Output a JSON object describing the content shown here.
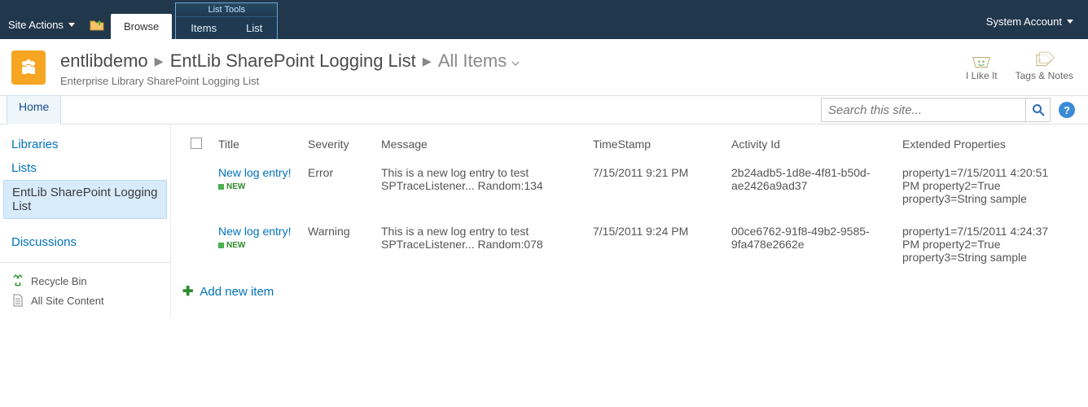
{
  "ribbon": {
    "site_actions": "Site Actions",
    "browse": "Browse",
    "list_tools_group": "List Tools",
    "items_tab": "Items",
    "list_tab": "List",
    "account": "System Account"
  },
  "title": {
    "site": "entlibdemo",
    "list": "EntLib SharePoint Logging List",
    "view": "All Items",
    "subtitle": "Enterprise Library SharePoint Logging List"
  },
  "social": {
    "like": "I Like It",
    "tags": "Tags & Notes"
  },
  "topnav": {
    "home": "Home"
  },
  "search": {
    "placeholder": "Search this site..."
  },
  "quicklaunch": {
    "libraries": "Libraries",
    "lists": "Lists",
    "current_list": "EntLib SharePoint Logging List",
    "discussions": "Discussions",
    "recycle": "Recycle Bin",
    "all_content": "All Site Content"
  },
  "list": {
    "columns": {
      "title": "Title",
      "severity": "Severity",
      "message": "Message",
      "timestamp": "TimeStamp",
      "activity": "Activity Id",
      "extended": "Extended Properties"
    },
    "new_badge": "NEW",
    "add_item": "Add new item",
    "rows": [
      {
        "title": "New log entry!",
        "severity": "Error",
        "message": "This is a new log entry to test SPTraceListener... Random:134",
        "timestamp": "7/15/2011 9:21 PM",
        "activity": "2b24adb5-1d8e-4f81-b50d-ae2426a9ad37",
        "extended": "property1=7/15/2011 4:20:51 PM property2=True property3=String sample"
      },
      {
        "title": "New log entry!",
        "severity": "Warning",
        "message": "This is a new log entry to test SPTraceListener... Random:078",
        "timestamp": "7/15/2011 9:24 PM",
        "activity": "00ce6762-91f8-49b2-9585-9fa478e2662e",
        "extended": "property1=7/15/2011 4:24:37 PM property2=True property3=String sample"
      }
    ]
  }
}
